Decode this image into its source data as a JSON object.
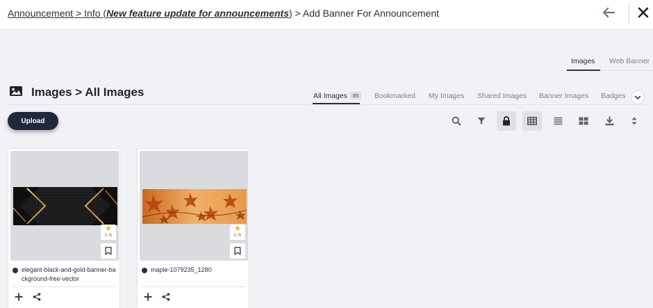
{
  "header": {
    "breadcrumb_root": "Announcement",
    "sep1": " > ",
    "crumb_info_prefix": "Info (",
    "crumb_info_name": "New feature update for announcements",
    "crumb_info_suffix": ")",
    "sep2": " > ",
    "crumb_current": "Add Banner For Announcement"
  },
  "top_tabs": {
    "images": "Images",
    "web_banner": "Web Banner",
    "active": "Images"
  },
  "section": {
    "title": "Images > All Images"
  },
  "filter_tabs": {
    "all_images": "All Images",
    "all_images_count": "85",
    "bookmarked": "Bookmarked",
    "my_images": "My Images",
    "shared_images": "Shared Images",
    "banner_images": "Banner Images",
    "badges": "Badges"
  },
  "upload": {
    "label": "Upload"
  },
  "toolbar": {
    "icons": [
      "search-icon",
      "filter-icon",
      "lock-icon",
      "grid-view-icon",
      "list-view-icon",
      "tile-view-icon",
      "download-icon",
      "sort-icon"
    ],
    "selected": [
      "lock-icon",
      "grid-view-icon"
    ]
  },
  "cards": [
    {
      "name": "elegant-black-and-gold-banner-background-free-vector",
      "rating": "0 /5"
    },
    {
      "name": "maple-1079235_1280",
      "rating": "0 /5"
    }
  ],
  "colors": {
    "accent": "#22273a",
    "star": "#f5b301",
    "selected_tool": "#dfe1e5"
  }
}
